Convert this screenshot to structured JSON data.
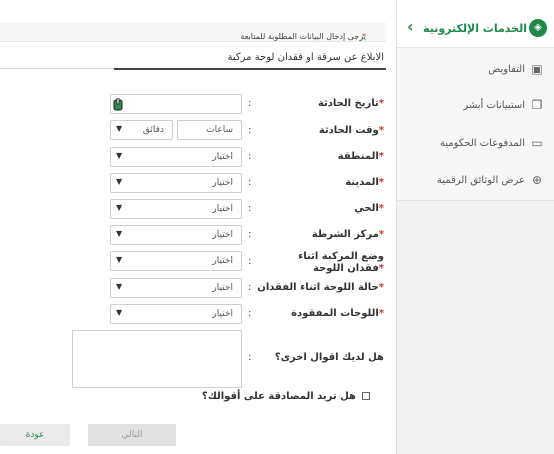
{
  "sidebar": {
    "title": "الخدمات الإلكترونية",
    "items": [
      {
        "label": "التفاويض",
        "icon": "briefcase-icon"
      },
      {
        "label": "استبيانات أبشر",
        "icon": "clipboard-icon"
      },
      {
        "label": "المدفوعات الحكومية",
        "icon": "credit-card-icon"
      },
      {
        "label": "عرض الوثائق الرقمية",
        "icon": "globe-icon"
      }
    ]
  },
  "form": {
    "notice": "يرجى إدخال البيانات المطلوبة للمتابعة",
    "notice_asterisk": "*",
    "title": "الابلاغ عن سرقة او فقدان لوحة مركبة",
    "colon": ":",
    "req": "*",
    "fields": {
      "accident_date": {
        "label": "تاريخ الحادثة",
        "value": ""
      },
      "accident_time": {
        "label": "وقت الحادثة",
        "hours": "ساعات",
        "minutes": "دقائق"
      },
      "region": {
        "label": "المنطقة",
        "value": "اختيار"
      },
      "city": {
        "label": "المدينة",
        "value": "اختيار"
      },
      "district": {
        "label": "الحي",
        "value": "اختيار"
      },
      "police_center": {
        "label": "مركز الشرطة",
        "value": "اختيار"
      },
      "vehicle_status": {
        "label": "وضع المركبة اثناء فقدان اللوحة",
        "value": "اختيار"
      },
      "plate_status": {
        "label": "حالة اللوحة اثناء الفقدان",
        "value": "اختيار"
      },
      "lost_plates": {
        "label": "اللوحات المفقودة",
        "value": "اختيار"
      },
      "other_statements": {
        "label": "هل لديك اقوال اخرى؟"
      }
    },
    "confirm_label": "هل تريد المصادقة على أقوالك؟",
    "next_label": "التالي",
    "back_label": "عودة"
  }
}
